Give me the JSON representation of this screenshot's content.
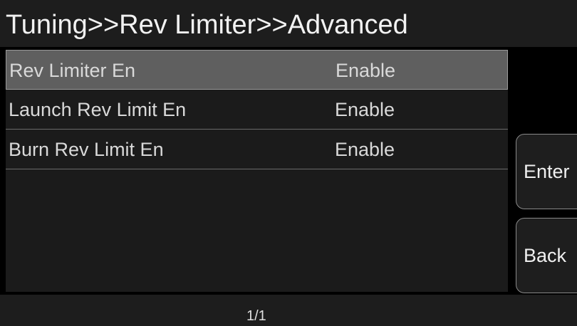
{
  "header": {
    "title": "Tuning>>Rev Limiter>>Advanced"
  },
  "list": {
    "rows": [
      {
        "label": "Rev Limiter En",
        "value": "Enable",
        "selected": true
      },
      {
        "label": "Launch Rev Limit En",
        "value": "Enable",
        "selected": false
      },
      {
        "label": "Burn Rev Limit En",
        "value": "Enable",
        "selected": false
      }
    ]
  },
  "buttons": {
    "enter_label": "Enter",
    "back_label": "Back"
  },
  "footer": {
    "page_indicator": "1/1"
  },
  "colors": {
    "background": "#000000",
    "bar": "#1d1d1d",
    "panel": "#1b1b1b",
    "selected_row": "#5f5f5f",
    "text": "#e6e6e6"
  }
}
